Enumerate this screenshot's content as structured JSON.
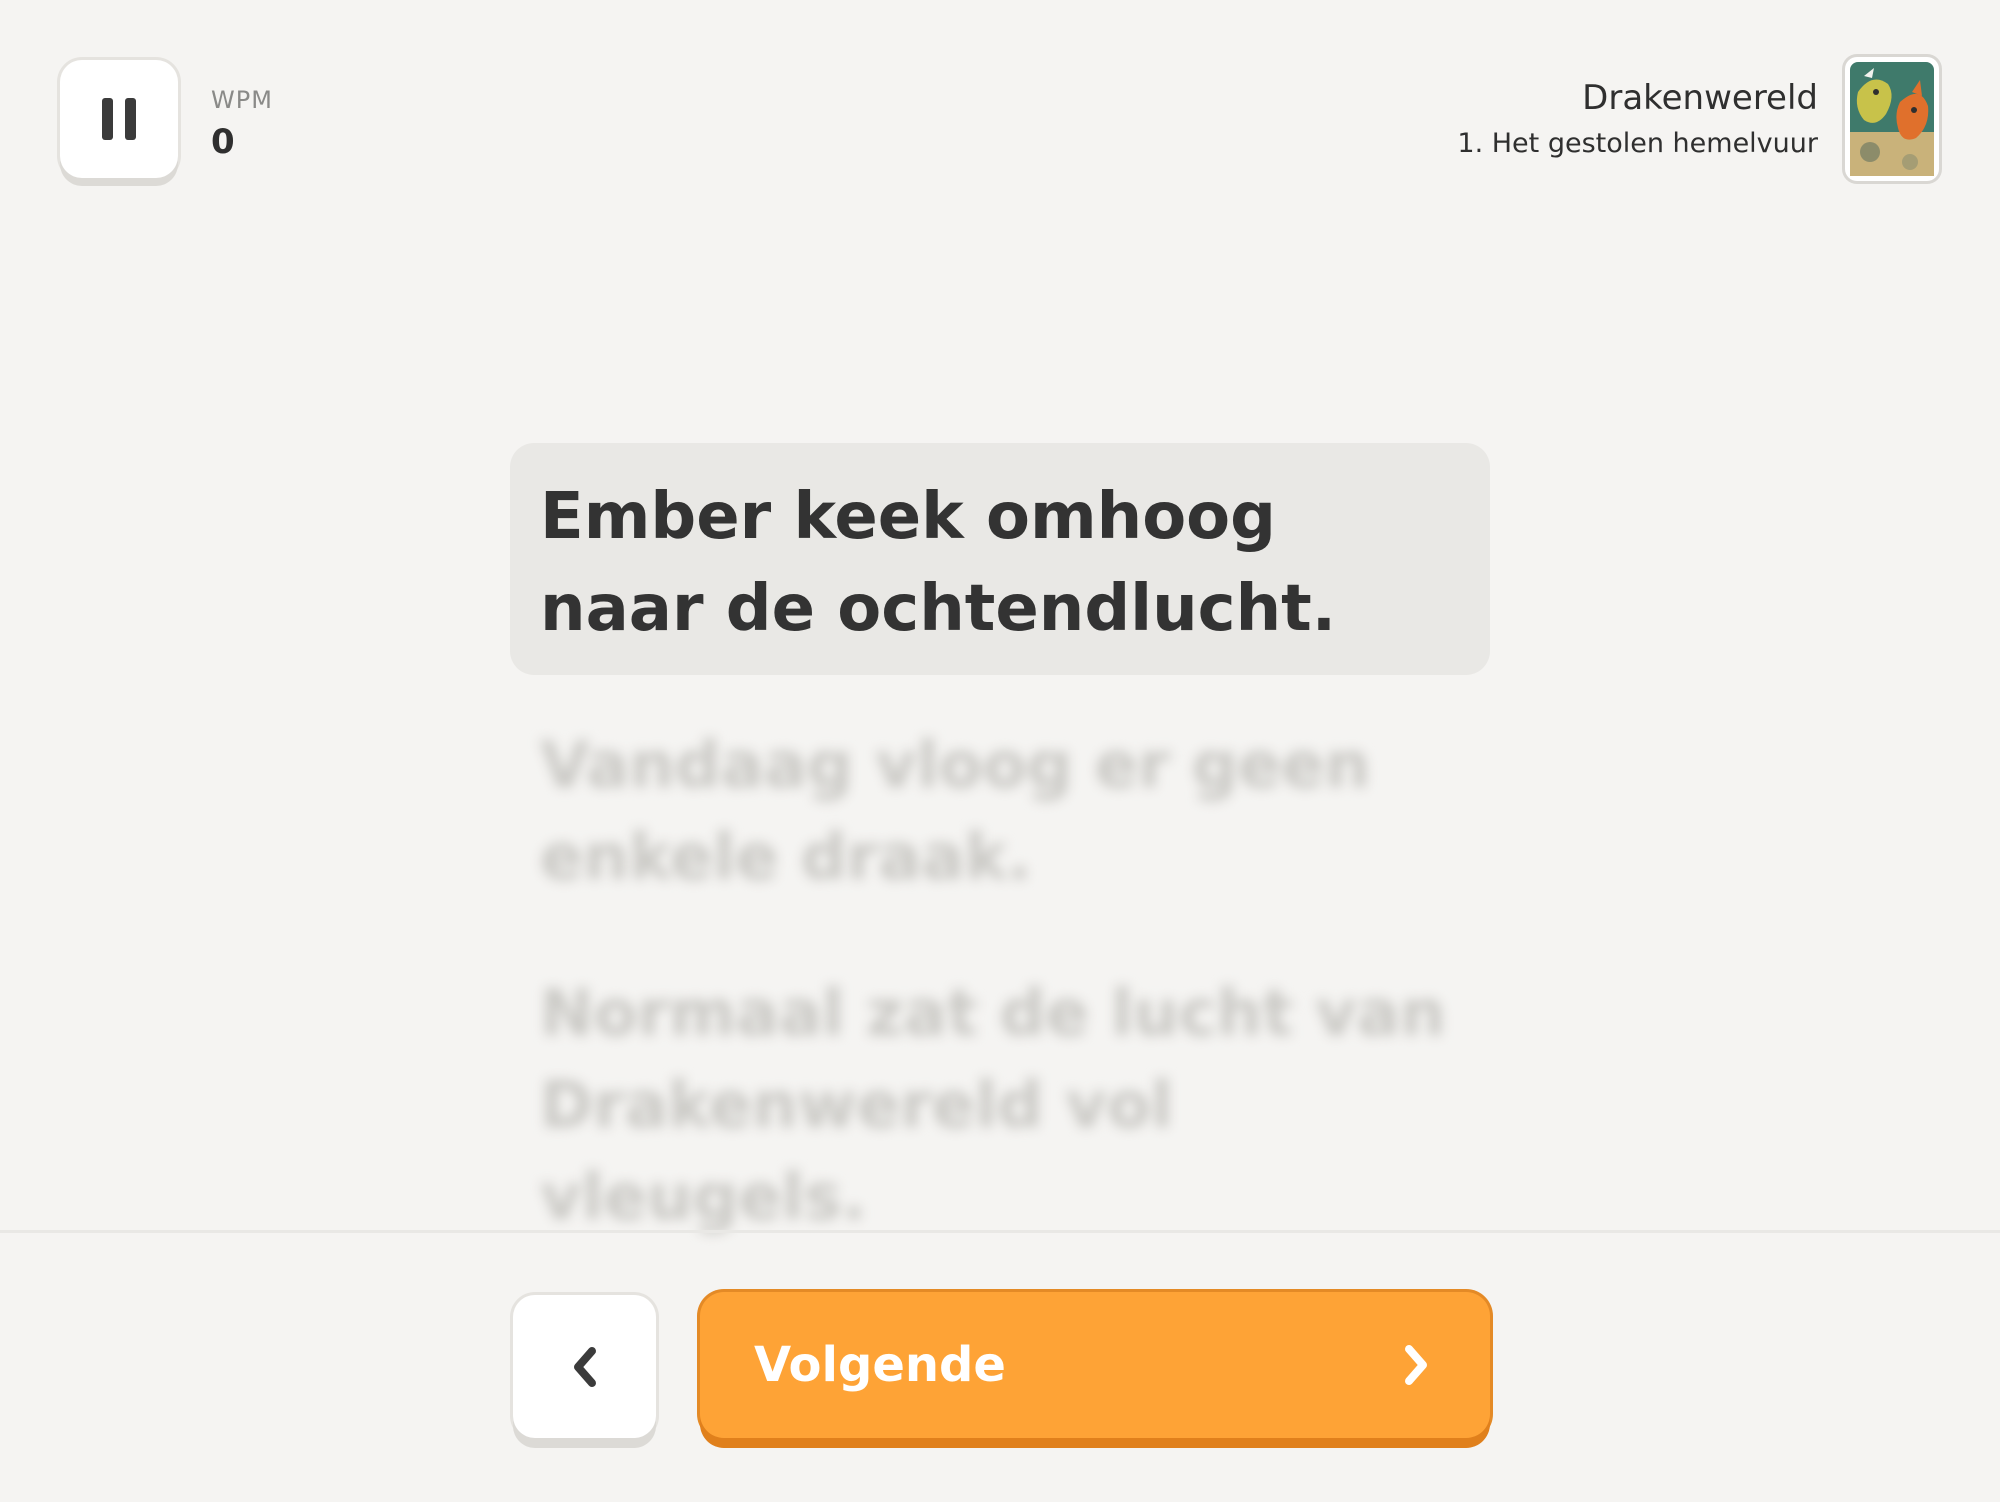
{
  "header": {
    "pause_icon": "pause-icon",
    "wpm_label": "WPM",
    "wpm_value": "0",
    "book_title": "Drakenwereld",
    "chapter_title": "1. Het gestolen hemelvuur",
    "cover_icon": "dragon-cover-image"
  },
  "reader": {
    "active_sentence": "Ember keek omhoog naar de ochtendlucht.",
    "upcoming_sentences": [
      "Vandaag vloog er geen enkele draak.",
      "Normaal zat de lucht van Drakenwereld vol vleugels."
    ]
  },
  "footer": {
    "back_icon": "chevron-left-icon",
    "next_label": "Volgende",
    "next_icon": "chevron-right-icon"
  },
  "colors": {
    "background": "#f5f4f2",
    "active_sentence_bg": "#e9e8e5",
    "accent": "#fea336",
    "text": "#333333"
  }
}
